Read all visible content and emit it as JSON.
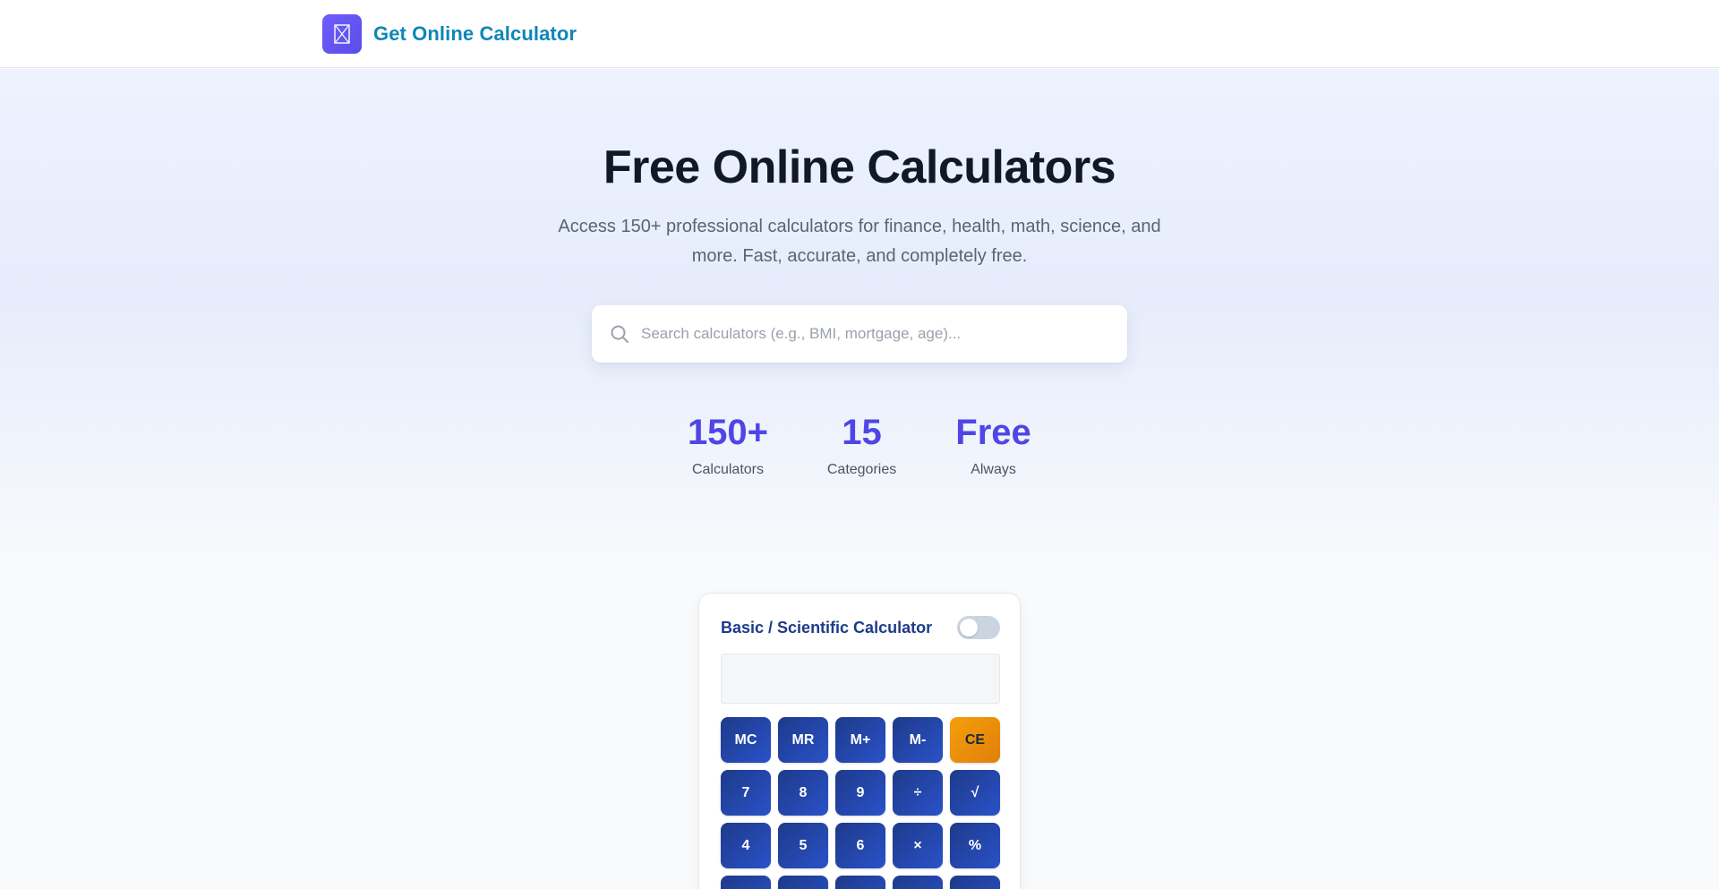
{
  "header": {
    "brand_name": "Get Online Calculator",
    "logo_icon": "calculator-icon"
  },
  "hero": {
    "title": "Free Online Calculators",
    "subtitle": "Access 150+ professional calculators for finance, health, math, science, and more. Fast, accurate, and completely free.",
    "search_placeholder": "Search calculators (e.g., BMI, mortgage, age)...",
    "search_value": "",
    "stats": [
      {
        "value": "150+",
        "label": "Calculators"
      },
      {
        "value": "15",
        "label": "Categories"
      },
      {
        "value": "Free",
        "label": "Always"
      }
    ]
  },
  "calculator": {
    "title": "Basic / Scientific Calculator",
    "scientific_mode": false,
    "display_value": "",
    "keys": [
      {
        "label": "MC",
        "accent": false
      },
      {
        "label": "MR",
        "accent": false
      },
      {
        "label": "M+",
        "accent": false
      },
      {
        "label": "M-",
        "accent": false
      },
      {
        "label": "CE",
        "accent": true
      },
      {
        "label": "7",
        "accent": false
      },
      {
        "label": "8",
        "accent": false
      },
      {
        "label": "9",
        "accent": false
      },
      {
        "label": "÷",
        "accent": false
      },
      {
        "label": "√",
        "accent": false
      },
      {
        "label": "4",
        "accent": false
      },
      {
        "label": "5",
        "accent": false
      },
      {
        "label": "6",
        "accent": false
      },
      {
        "label": "×",
        "accent": false
      },
      {
        "label": "%",
        "accent": false
      },
      {
        "label": "",
        "accent": false
      },
      {
        "label": "",
        "accent": false
      },
      {
        "label": "",
        "accent": false
      },
      {
        "label": "",
        "accent": false
      },
      {
        "label": "",
        "accent": false
      }
    ]
  },
  "colors": {
    "brand_text": "#0e86b8",
    "stat_accent": "#4f46e5",
    "key_primary": "#1e3a8a",
    "key_accent": "#f59e0b"
  }
}
